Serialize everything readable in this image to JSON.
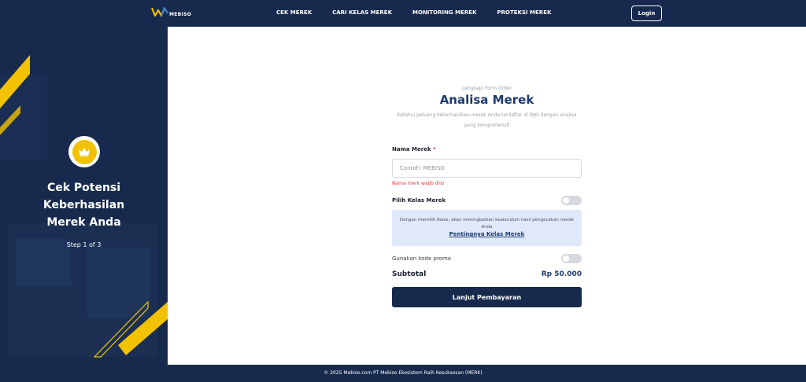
{
  "navbar": {
    "logo_text": "MEBISO",
    "links": [
      "CEK MEREK",
      "CARI KELAS MEREK",
      "MONITORING MEREK",
      "PROTEKSI MEREK"
    ],
    "login_label": "Login"
  },
  "sidebar": {
    "icon": "crown-icon",
    "heading": "Cek Potensi\nKeberhasilan\nMerek Anda",
    "step": "Step 1 of 3"
  },
  "form": {
    "eyebrow": "Lengkapi Form Order",
    "title": "Analisa Merek",
    "subtitle": "Ketahui peluang keberhasilkan merek Anda terdaftar di DJKI dengan analisa yang komprehensif",
    "name_label": "Nama Merek",
    "required_mark": "*",
    "name_placeholder": "Contoh: MEBISO",
    "name_value": "",
    "name_error": "Nama merk wajib diisi",
    "kelas_label": "Pilih Kelas Merek",
    "kelas_toggle_on": false,
    "info_text": "Dengan memilih Kelas, akan meningkatkan keakuratan hasil pengecekan merek Anda",
    "info_link": "Pentingnya Kelas Merek",
    "promo_label": "Gunakan kode promo",
    "promo_toggle_on": false,
    "subtotal_label": "Subtotal",
    "subtotal_value": "Rp 50.000",
    "submit_label": "Lanjut Pembayaran"
  },
  "footer": {
    "text": "© 2025 Mebiso.com PT Mebiso Ekosistem Raih Kesuksesan (MERK)"
  },
  "colors": {
    "navy": "#172a4e",
    "title_blue": "#1e3a6e",
    "accent_yellow": "#f2c200",
    "error_red": "#e03a3a",
    "info_bg": "#dfe9fb"
  }
}
